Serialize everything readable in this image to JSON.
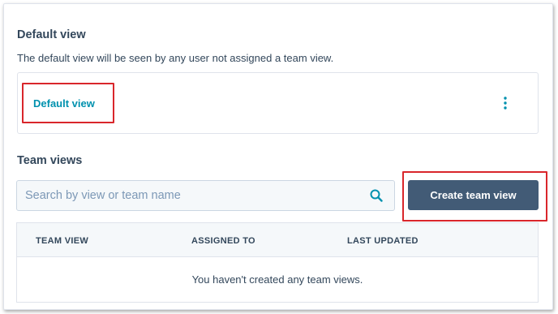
{
  "default_section": {
    "title": "Default view",
    "description": "The default view will be seen by any user not assigned a team view.",
    "card_link": "Default view"
  },
  "team_section": {
    "title": "Team views",
    "search": {
      "placeholder": "Search by view or team name",
      "value": ""
    },
    "create_button": "Create team view",
    "table": {
      "columns": [
        "TEAM VIEW",
        "ASSIGNED TO",
        "LAST UPDATED"
      ],
      "empty_message": "You haven't created any team views."
    }
  },
  "colors": {
    "link": "#0091ae",
    "primary_button": "#425b76",
    "highlight": "#d9262b",
    "text": "#33475b"
  },
  "icons": {
    "more": "vertical-ellipsis-icon",
    "search": "search-icon"
  }
}
